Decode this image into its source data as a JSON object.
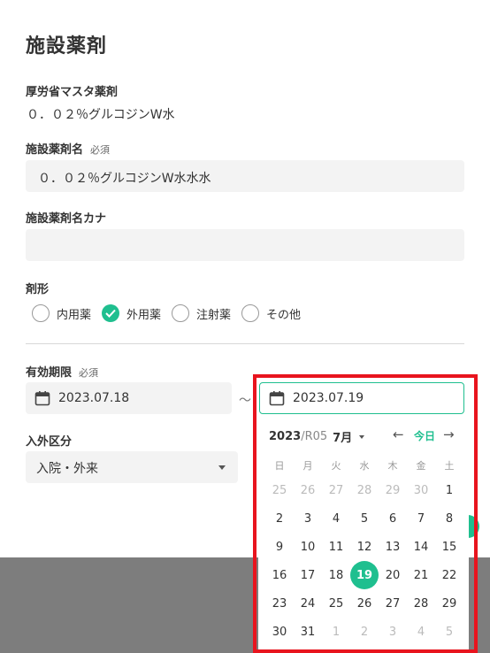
{
  "page": {
    "title": "施設薬剤",
    "required_tag": "必須",
    "master": {
      "label": "厚労省マスタ薬剤",
      "value": "０．０２％グルコジンW水"
    },
    "name": {
      "label": "施設薬剤名",
      "value": "０．０２％グルコジンW水水水"
    },
    "kana": {
      "label": "施設薬剤名カナ",
      "value": ""
    },
    "form": {
      "label": "剤形",
      "options": [
        "内用薬",
        "外用薬",
        "注射薬",
        "その他"
      ],
      "selected": "外用薬"
    },
    "expiry": {
      "label": "有効期限",
      "start": "2023.07.18",
      "separator": "〜",
      "end": "2023.07.19"
    },
    "inout": {
      "label": "入外区分",
      "value": "入院・外来"
    }
  },
  "datepicker": {
    "year": "2023",
    "era": "/R05",
    "month": "7月",
    "today_label": "今日",
    "prev_icon": "←",
    "next_icon": "→",
    "weekdays": [
      "日",
      "月",
      "火",
      "水",
      "木",
      "金",
      "土"
    ],
    "weeks": [
      [
        "25",
        "26",
        "27",
        "28",
        "29",
        "30",
        "1"
      ],
      [
        "2",
        "3",
        "4",
        "5",
        "6",
        "7",
        "8"
      ],
      [
        "9",
        "10",
        "11",
        "12",
        "13",
        "14",
        "15"
      ],
      [
        "16",
        "17",
        "18",
        "19",
        "20",
        "21",
        "22"
      ],
      [
        "23",
        "24",
        "25",
        "26",
        "27",
        "28",
        "29"
      ],
      [
        "30",
        "31",
        "1",
        "2",
        "3",
        "4",
        "5"
      ]
    ],
    "selected_day": "19",
    "accent_color": "#1fbf8f"
  },
  "highlight_color": "#e8141e"
}
